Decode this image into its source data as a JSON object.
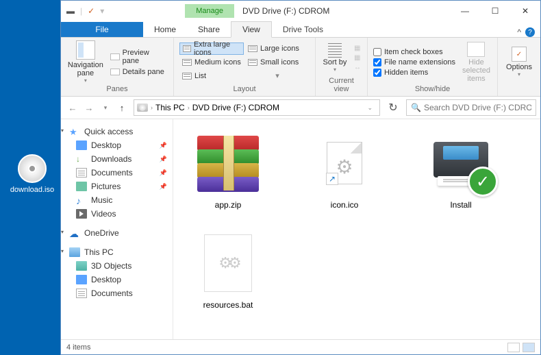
{
  "desktop": {
    "file": "download.iso"
  },
  "window": {
    "title": "DVD Drive (F:) CDROM",
    "contextTab": "Manage",
    "contextGroup": "Drive Tools",
    "tabs": {
      "file": "File",
      "home": "Home",
      "share": "Share",
      "view": "View"
    }
  },
  "ribbon": {
    "panes": {
      "nav": "Navigation pane",
      "preview": "Preview pane",
      "details": "Details pane",
      "group": "Panes"
    },
    "layout": {
      "xl": "Extra large icons",
      "lg": "Large icons",
      "md": "Medium icons",
      "sm": "Small icons",
      "list": "List",
      "group": "Layout"
    },
    "current": {
      "sort": "Sort by",
      "group": "Current view"
    },
    "showhide": {
      "chk1": "Item check boxes",
      "chk2": "File name extensions",
      "chk3": "Hidden items",
      "hide": "Hide selected items",
      "group": "Show/hide"
    },
    "options": "Options"
  },
  "address": {
    "thispc": "This PC",
    "location": "DVD Drive (F:) CDROM",
    "searchPlaceholder": "Search DVD Drive (F:) CDROM"
  },
  "sidebar": {
    "quick": "Quick access",
    "desktop": "Desktop",
    "downloads": "Downloads",
    "documents": "Documents",
    "pictures": "Pictures",
    "music": "Music",
    "videos": "Videos",
    "onedrive": "OneDrive",
    "thispc": "This PC",
    "obj3d": "3D Objects",
    "desktop2": "Desktop",
    "documents2": "Documents"
  },
  "files": {
    "f1": "app.zip",
    "f2": "icon.ico",
    "f3": "Install",
    "f4": "resources.bat"
  },
  "status": {
    "count": "4 items"
  }
}
